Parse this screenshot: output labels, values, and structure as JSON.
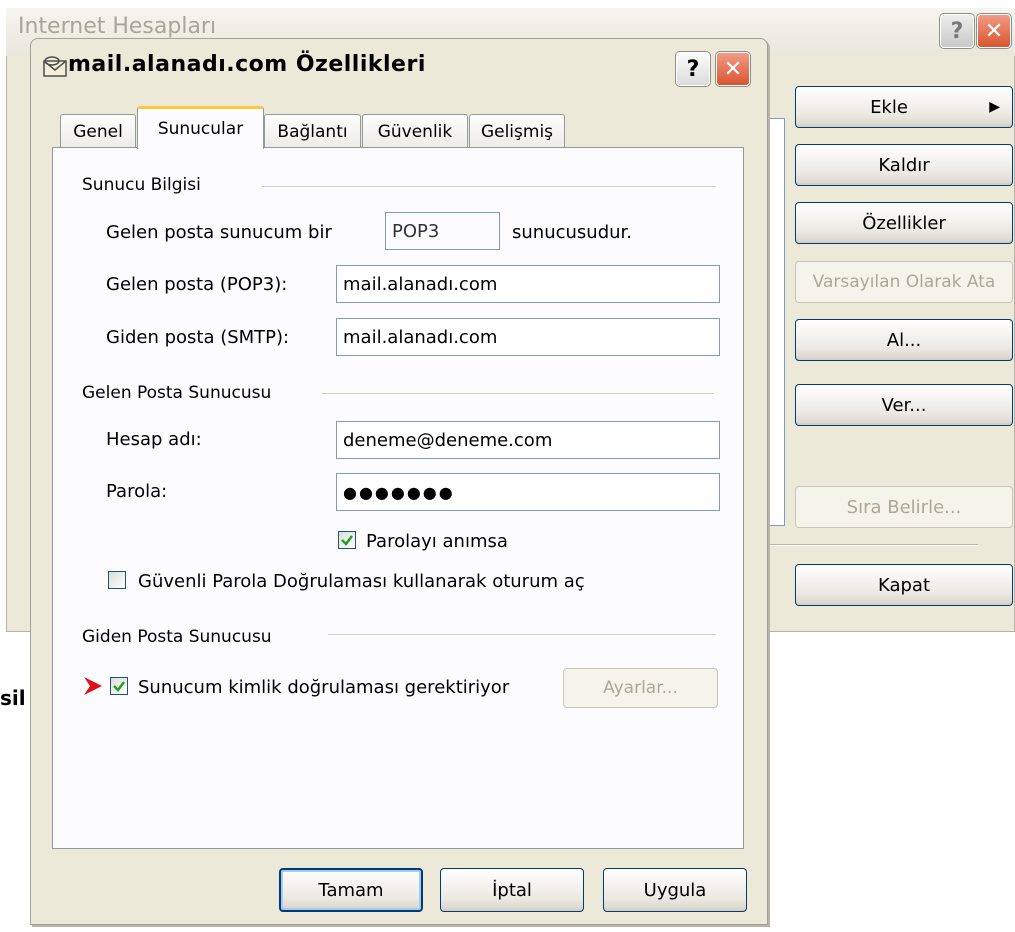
{
  "background_window": {
    "title": "Internet Hesapları",
    "help_glyph": "?",
    "close_glyph": "✕",
    "buttons": {
      "add": "Ekle",
      "add_arrow": "▶",
      "remove": "Kaldır",
      "properties": "Özellikler",
      "set_default": "Varsayılan Olarak Ata",
      "import": "Al...",
      "export": "Ver...",
      "set_order": "Sıra Belirle...",
      "close": "Kapat"
    },
    "left_text": "sil"
  },
  "dialog": {
    "title": "mail.alanadı.com Özellikleri",
    "help_glyph": "?",
    "close_glyph": "✕",
    "tabs": [
      {
        "label": "Genel",
        "active": false
      },
      {
        "label": "Sunucular",
        "active": true
      },
      {
        "label": "Bağlantı",
        "active": false
      },
      {
        "label": "Güvenlik",
        "active": false
      },
      {
        "label": "Gelişmiş",
        "active": false
      }
    ],
    "server_info": {
      "heading": "Sunucu Bilgisi",
      "incoming_type_prefix": "Gelen posta sunucum bir",
      "incoming_type_value": "POP3",
      "incoming_type_suffix": "sunucusudur.",
      "incoming_label": "Gelen posta (POP3):",
      "incoming_value": "mail.alanadı.com",
      "outgoing_label": "Giden posta (SMTP):",
      "outgoing_value": "mail.alanadı.com"
    },
    "incoming_server": {
      "heading": "Gelen Posta Sunucusu",
      "account_label": "Hesap adı:",
      "account_value": "deneme@deneme.com",
      "password_label": "Parola:",
      "password_value": "●●●●●●●",
      "remember_label": "Parolayı anımsa",
      "remember_checked": true,
      "spa_label": "Güvenli Parola Doğrulaması kullanarak oturum aç",
      "spa_checked": false
    },
    "outgoing_server": {
      "heading": "Giden Posta Sunucusu",
      "auth_label": "Sunucum kimlik doğrulaması gerektiriyor",
      "auth_checked": true,
      "settings_button": "Ayarlar..."
    },
    "footer": {
      "ok": "Tamam",
      "cancel": "İptal",
      "apply": "Uygula"
    }
  },
  "colors": {
    "dialog_bg": "#ece9d8",
    "close_red": "#d8552f",
    "tab_highlight": "#ffc83c",
    "checkmark_green": "#21a121",
    "pointer_arrow_red": "#e0101a"
  }
}
